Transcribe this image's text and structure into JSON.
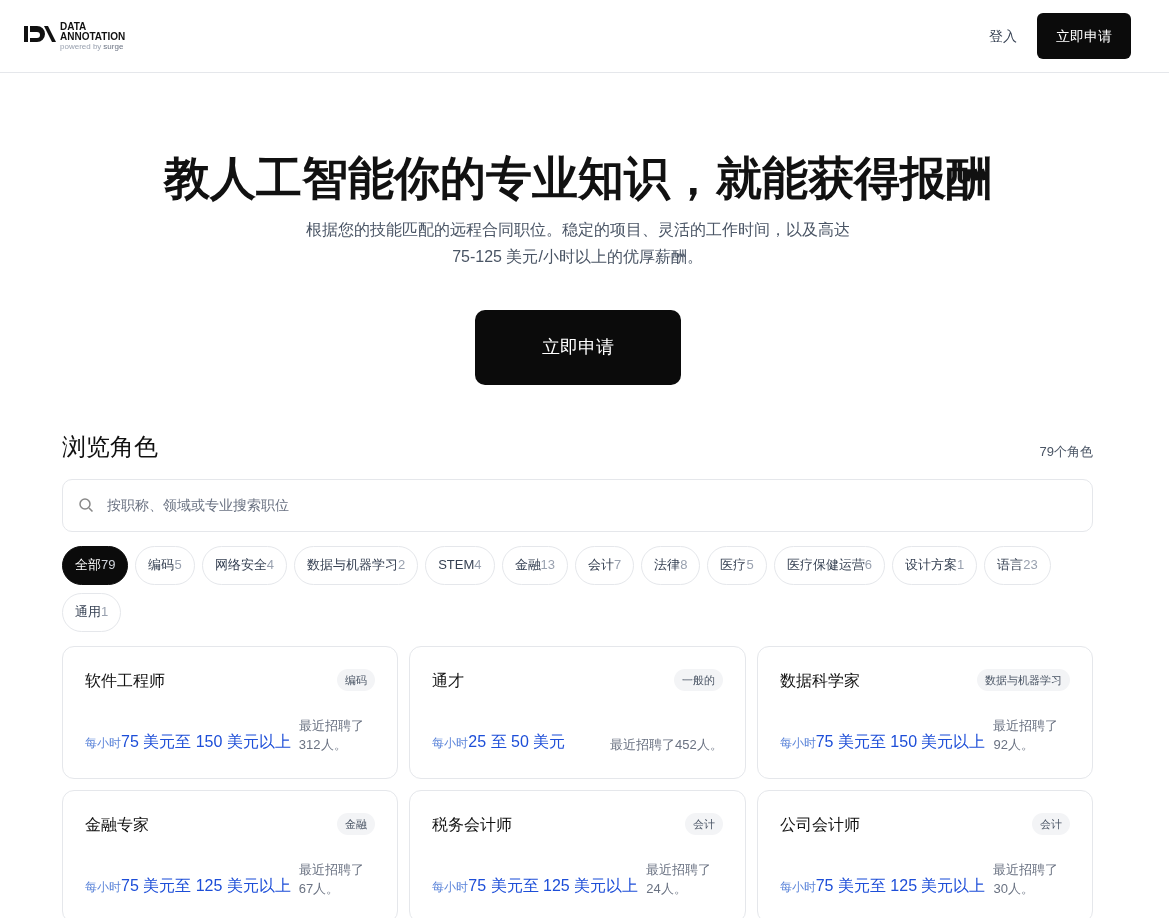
{
  "header": {
    "logo": {
      "line1": "DATA",
      "line2": "ANNOTATION",
      "powered_by": "powered by",
      "brand": "surge"
    },
    "login": "登入",
    "apply": "立即申请"
  },
  "hero": {
    "title": "教人工智能你的专业知识，就能获得报酬",
    "subtitle_line1": "根据您的技能匹配的远程合同职位。稳定的项目、灵活的工作时间，以及高达",
    "subtitle_line2": "75-125 美元/小时以上的优厚薪酬。",
    "cta": "立即申请"
  },
  "browse": {
    "title": "浏览角色",
    "count": "79个角色",
    "search": {
      "placeholder": "按职称、领域或专业搜索职位"
    },
    "filters": [
      {
        "label": "全部",
        "count": "79",
        "selected": true
      },
      {
        "label": "编码",
        "count": "5",
        "selected": false
      },
      {
        "label": "网络安全",
        "count": "4",
        "selected": false
      },
      {
        "label": "数据与机器学习",
        "count": "2",
        "selected": false
      },
      {
        "label": "STEM",
        "count": "4",
        "selected": false
      },
      {
        "label": "金融",
        "count": "13",
        "selected": false
      },
      {
        "label": "会计",
        "count": "7",
        "selected": false
      },
      {
        "label": "法律",
        "count": "8",
        "selected": false
      },
      {
        "label": "医疗",
        "count": "5",
        "selected": false
      },
      {
        "label": "医疗保健运营",
        "count": "6",
        "selected": false
      },
      {
        "label": "设计方案",
        "count": "1",
        "selected": false
      },
      {
        "label": "语言",
        "count": "23",
        "selected": false
      },
      {
        "label": "通用",
        "count": "1",
        "selected": false
      }
    ],
    "roles": [
      {
        "title": "软件工程师",
        "tag": "编码",
        "rate_prefix": "每小时",
        "rate": "75 美元至 150 美元以上",
        "hired": "最近招聘了312人。"
      },
      {
        "title": "通才",
        "tag": "一般的",
        "rate_prefix": "每小时",
        "rate": "25 至 50 美元",
        "hired": "最近招聘了452人。"
      },
      {
        "title": "数据科学家",
        "tag": "数据与机器学习",
        "rate_prefix": "每小时",
        "rate": "75 美元至 150 美元以上",
        "hired": "最近招聘了92人。"
      },
      {
        "title": "金融专家",
        "tag": "金融",
        "rate_prefix": "每小时",
        "rate": "75 美元至 125 美元以上",
        "hired": "最近招聘了67人。"
      },
      {
        "title": "税务会计师",
        "tag": "会计",
        "rate_prefix": "每小时",
        "rate": "75 美元至 125 美元以上",
        "hired": "最近招聘了24人。"
      },
      {
        "title": "公司会计师",
        "tag": "会计",
        "rate_prefix": "每小时",
        "rate": "75 美元至 125 美元以上",
        "hired": "最近招聘了30人。"
      }
    ]
  }
}
